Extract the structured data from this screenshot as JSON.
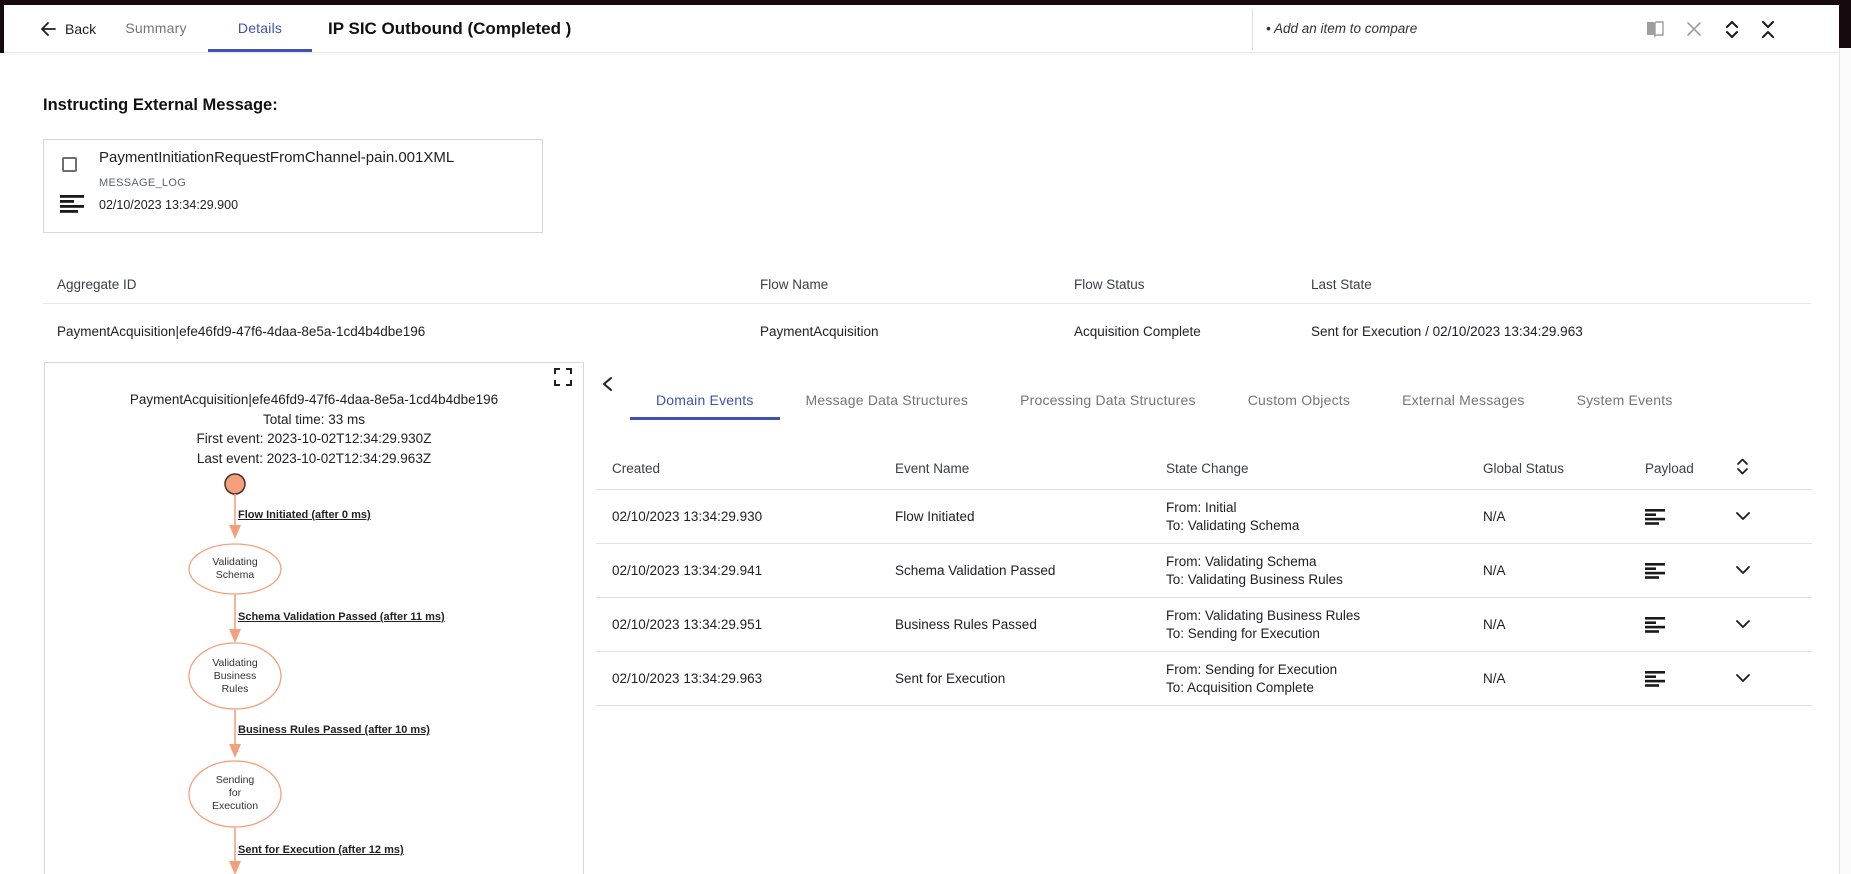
{
  "header": {
    "back_label": "Back",
    "tab_summary": "Summary",
    "tab_details": "Details",
    "title": "IP SIC Outbound (Completed )",
    "compare_hint": "• Add an item to compare",
    "icons": [
      "compare-panel-icon",
      "close-icon",
      "unfold-more-icon",
      "unfold-less-icon"
    ]
  },
  "section_title": "Instructing External Message:",
  "message_card": {
    "title": "PaymentInitiationRequestFromChannel-pain.001XML",
    "type_label": "MESSAGE_LOG",
    "timestamp": "02/10/2023 13:34:29.900",
    "icons": [
      "checkbox",
      "payload-log-icon"
    ]
  },
  "summary_table": {
    "columns": [
      "Aggregate ID",
      "Flow Name",
      "Flow Status",
      "Last State"
    ],
    "row": {
      "aggregate_id": "PaymentAcquisition|efe46fd9-47f6-4daa-8e5a-1cd4b4dbe196",
      "flow_name": "PaymentAcquisition",
      "flow_status": "Acquisition Complete",
      "last_state": "Sent for Execution / 02/10/2023 13:34:29.963"
    }
  },
  "flow_panel": {
    "title": "PaymentAcquisition|efe46fd9-47f6-4daa-8e5a-1cd4b4dbe196",
    "total_time": "Total time: 33 ms",
    "first_event": "First event: 2023-10-02T12:34:29.930Z",
    "last_event": "Last event: 2023-10-02T12:34:29.963Z",
    "edges": [
      {
        "label": "Flow Initiated (after 0 ms)"
      },
      {
        "label": "Schema Validation Passed (after 11 ms)"
      },
      {
        "label": "Business Rules Passed (after 10 ms)"
      },
      {
        "label": "Sent for Execution (after 12 ms)"
      }
    ],
    "nodes": [
      {
        "label": "Validating\nSchema"
      },
      {
        "label": "Validating\nBusiness\nRules"
      },
      {
        "label": "Sending\nfor\nExecution"
      }
    ]
  },
  "detail_tabs": {
    "items": [
      "Domain Events",
      "Message Data Structures",
      "Processing Data Structures",
      "Custom Objects",
      "External Messages",
      "System Events"
    ],
    "active": "Domain Events"
  },
  "events_table": {
    "columns": [
      "Created",
      "Event Name",
      "State Change",
      "Global Status",
      "Payload"
    ],
    "rows": [
      {
        "created": "02/10/2023 13:34:29.930",
        "event_name": "Flow Initiated",
        "from": "From: Initial",
        "to": "To: Validating Schema",
        "global_status": "N/A"
      },
      {
        "created": "02/10/2023 13:34:29.941",
        "event_name": "Schema Validation Passed",
        "from": "From: Validating Schema",
        "to": "To: Validating Business Rules",
        "global_status": "N/A"
      },
      {
        "created": "02/10/2023 13:34:29.951",
        "event_name": "Business Rules Passed",
        "from": "From: Validating Business Rules",
        "to": "To: Sending for Execution",
        "global_status": "N/A"
      },
      {
        "created": "02/10/2023 13:34:29.963",
        "event_name": "Sent for Execution",
        "from": "From: Sending for Execution",
        "to": "To: Acquisition Complete",
        "global_status": "N/A"
      }
    ]
  },
  "colors": {
    "accent_indigo": "#3f51b5",
    "flow_salmon": "#f2a17c",
    "flow_node_border_dark": "#4a2e28",
    "frame_dark": "#160a0e",
    "text_primary": "#202124",
    "text_secondary": "#757575"
  }
}
